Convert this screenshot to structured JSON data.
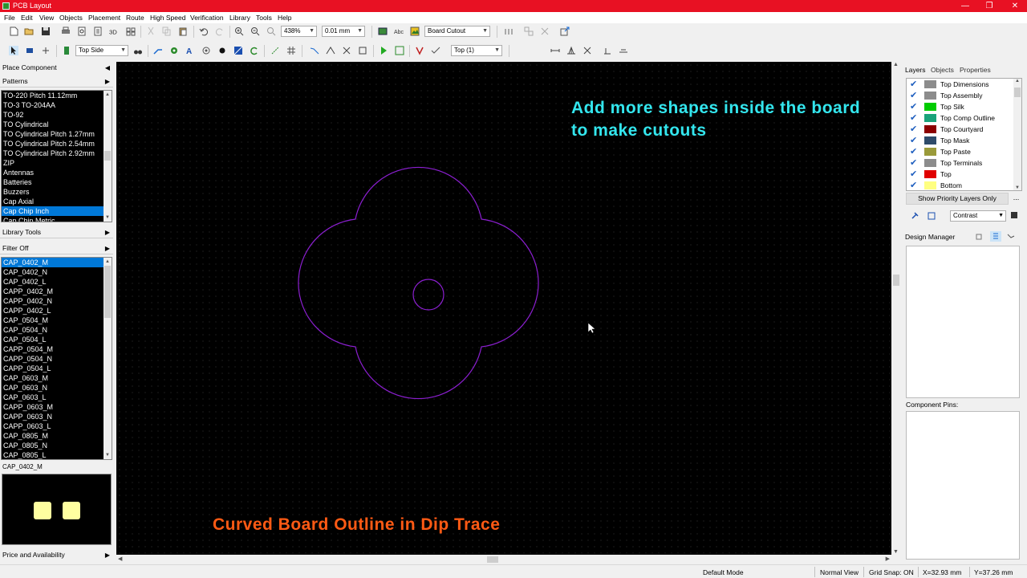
{
  "window": {
    "title": "PCB Layout"
  },
  "menu": [
    "File",
    "Edit",
    "View",
    "Objects",
    "Placement",
    "Route",
    "High Speed",
    "Verification",
    "Library",
    "Tools",
    "Help"
  ],
  "toolbar1": {
    "zoom": "438%",
    "grid": "0.01 mm",
    "layer_mode": "Board Cutout"
  },
  "toolbar2": {
    "side": "Top Side",
    "layer": "Top (1)"
  },
  "left_panel": {
    "place_component": "Place Component",
    "patterns_header": "Patterns",
    "patterns": [
      "TO-220 Pitch 11.12mm",
      "TO-3 TO-204AA",
      "TO-92",
      "TO Cylindrical",
      "TO Cylindrical Pitch 1.27mm",
      "TO Cylindrical Pitch 2.54mm",
      "TO Cylindrical Pitch 2.92mm",
      "ZIP",
      "Antennas",
      "Batteries",
      "Buzzers",
      "Cap Axial",
      "Cap Chip Inch",
      "Cap Chip Metric"
    ],
    "patterns_selected": 12,
    "library_tools": "Library Tools",
    "filter": "Filter Off",
    "components": [
      "CAP_0402_M",
      "CAP_0402_N",
      "CAP_0402_L",
      "CAPP_0402_M",
      "CAPP_0402_N",
      "CAPP_0402_L",
      "CAP_0504_M",
      "CAP_0504_N",
      "CAP_0504_L",
      "CAPP_0504_M",
      "CAPP_0504_N",
      "CAPP_0504_L",
      "CAP_0603_M",
      "CAP_0603_N",
      "CAP_0603_L",
      "CAPP_0603_M",
      "CAPP_0603_N",
      "CAPP_0603_L",
      "CAP_0805_M",
      "CAP_0805_N",
      "CAP_0805_L"
    ],
    "components_selected": 0,
    "preview_name": "CAP_0402_M",
    "price": "Price and Availability"
  },
  "annotations": {
    "top": "Add more shapes inside the board to make cutouts",
    "bottom": "Curved Board Outline in Dip Trace"
  },
  "board": {
    "outline_color": "#8b1fd0"
  },
  "right_panel": {
    "tabs": [
      "Layers",
      "Objects",
      "Properties"
    ],
    "layers": [
      {
        "name": "Top Dimensions",
        "color": "#8c8c8c"
      },
      {
        "name": "Top Assembly",
        "color": "#8c8c8c"
      },
      {
        "name": "Top Silk",
        "color": "#00cc00"
      },
      {
        "name": "Top Comp Outline",
        "color": "#1aa37a"
      },
      {
        "name": "Top Courtyard",
        "color": "#8b0000"
      },
      {
        "name": "Top Mask",
        "color": "#2e4b6a"
      },
      {
        "name": "Top Paste",
        "color": "#9a9a3a"
      },
      {
        "name": "Top Terminals",
        "color": "#8c8c8c"
      },
      {
        "name": "Top",
        "color": "#e00000"
      },
      {
        "name": "Bottom",
        "color": "#ffff80"
      }
    ],
    "priority_btn": "Show Priority Layers Only",
    "more": "...",
    "contrast": "Contrast",
    "design_manager": "Design Manager",
    "component_pins": "Component Pins:"
  },
  "status": {
    "mode": "Default Mode",
    "view": "Normal View",
    "snap": "Grid Snap: ON",
    "x": "X=32.93 mm",
    "y": "Y=37.26 mm"
  }
}
